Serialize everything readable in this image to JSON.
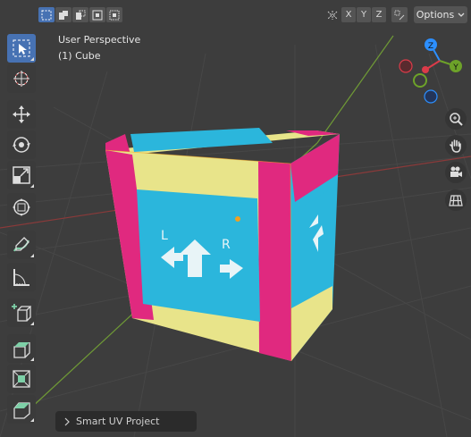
{
  "viewport": {
    "perspective_label": "User Perspective",
    "object_label": "(1) Cube"
  },
  "header": {
    "select_modes": [
      "select-set-icon",
      "select-extend-icon",
      "select-subtract-icon",
      "select-invert-icon",
      "select-intersect-icon"
    ],
    "mirror_axes": [
      "X",
      "Y",
      "Z"
    ],
    "options_label": "Options"
  },
  "toolbar": {
    "tools": [
      "select-box",
      "cursor",
      "move",
      "rotate",
      "scale",
      "transform",
      "annotate",
      "measure",
      "add-cube",
      "extrude-region",
      "inset-faces",
      "bevel"
    ]
  },
  "gizmo": {
    "z_label": "Z",
    "y_label": "Y",
    "x_color": "#db3b49",
    "y_color": "#6da229",
    "z_color": "#2c8fff"
  },
  "nav_buttons": [
    "zoom-icon",
    "hand-pan-icon",
    "camera-icon",
    "grid-view-icon"
  ],
  "operator_panel": {
    "label": "Smart UV Project"
  },
  "colors": {
    "accent": "#4772b3",
    "cube_pink": "#e0297f",
    "cube_yellow": "#e8e48a",
    "cube_cyan": "#2bb6dc"
  }
}
